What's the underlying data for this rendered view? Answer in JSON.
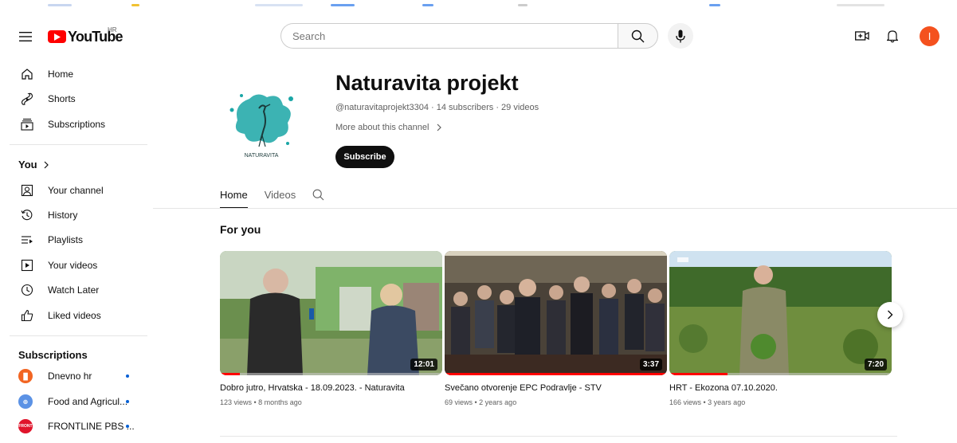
{
  "header": {
    "logo_text": "YouTube",
    "country_code": "HR",
    "search_placeholder": "Search",
    "avatar_letter": "I"
  },
  "sidebar": {
    "main": [
      {
        "label": "Home",
        "icon": "home-icon"
      },
      {
        "label": "Shorts",
        "icon": "shorts-icon"
      },
      {
        "label": "Subscriptions",
        "icon": "subscriptions-icon"
      }
    ],
    "you_heading": "You",
    "you_items": [
      {
        "label": "Your channel",
        "icon": "your-channel-icon"
      },
      {
        "label": "History",
        "icon": "history-icon"
      },
      {
        "label": "Playlists",
        "icon": "playlists-icon"
      },
      {
        "label": "Your videos",
        "icon": "your-videos-icon"
      },
      {
        "label": "Watch Later",
        "icon": "watch-later-icon"
      },
      {
        "label": "Liked videos",
        "icon": "liked-videos-icon"
      }
    ],
    "subscriptions_heading": "Subscriptions",
    "subscriptions": [
      {
        "label": "Dnevno hr",
        "color": "#f26522"
      },
      {
        "label": "Food and Agricul...",
        "color": "#5b92e5"
      },
      {
        "label": "FRONTLINE PBS ...",
        "color": "#e0142b"
      }
    ]
  },
  "channel": {
    "name": "Naturavita projekt",
    "meta": "@naturavitaprojekt3304 · 14 subscribers · 29 videos",
    "more_link": "More about this channel",
    "subscribe_label": "Subscribe",
    "logo_caption": "NATURAVITA"
  },
  "tabs": [
    {
      "label": "Home",
      "active": true
    },
    {
      "label": "Videos",
      "active": false
    }
  ],
  "section_title": "For you",
  "videos": [
    {
      "title": "Dobro jutro, Hrvatska - 18.09.2023. - Naturavita",
      "meta": "123 views • 8 months ago",
      "duration": "12:01",
      "progress": 0.09
    },
    {
      "title": "Svečano otvorenje EPC Podravlje - STV",
      "meta": "69 views • 2 years ago",
      "duration": "3:37",
      "progress": 1.0
    },
    {
      "title": "HRT - Ekozona 07.10.2020.",
      "meta": "166 views • 3 years ago",
      "duration": "7:20",
      "progress": 0.26
    }
  ],
  "colors": {
    "brand_red": "#ff0000",
    "avatar": "#f4511e",
    "subscribe_bg": "#0f0f0f",
    "logo_teal": "#1aa6a6"
  }
}
